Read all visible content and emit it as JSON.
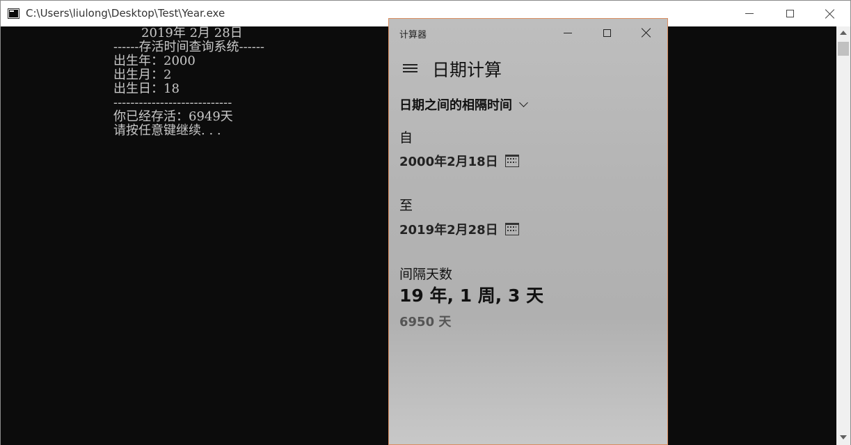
{
  "console": {
    "title": "C:\\Users\\liulong\\Desktop\\Test\\Year.exe",
    "lines": [
      "       2019年 2月 28日",
      "------存活时间查询系统------",
      "出生年：2000",
      "出生月：2",
      "出生日：18",
      "----------------------------",
      "你已经存活：6949天",
      "请按任意键继续. . ."
    ]
  },
  "calculator": {
    "title": "计算器",
    "mode": "日期计算",
    "calc_type": "日期之间的相隔时间",
    "from_label": "自",
    "from_date": "2000年2月18日",
    "to_label": "至",
    "to_date": "2019年2月28日",
    "diff_label": "间隔天数",
    "diff_value": "19 年, 1 周, 3 天",
    "diff_days": "6950 天"
  },
  "icons": {
    "console_app": "console-app-icon",
    "minimize": "minimize-icon",
    "maximize": "maximize-icon",
    "close": "close-icon",
    "hamburger": "hamburger-menu-icon",
    "chevron": "chevron-down-icon",
    "calendar": "calendar-icon"
  }
}
